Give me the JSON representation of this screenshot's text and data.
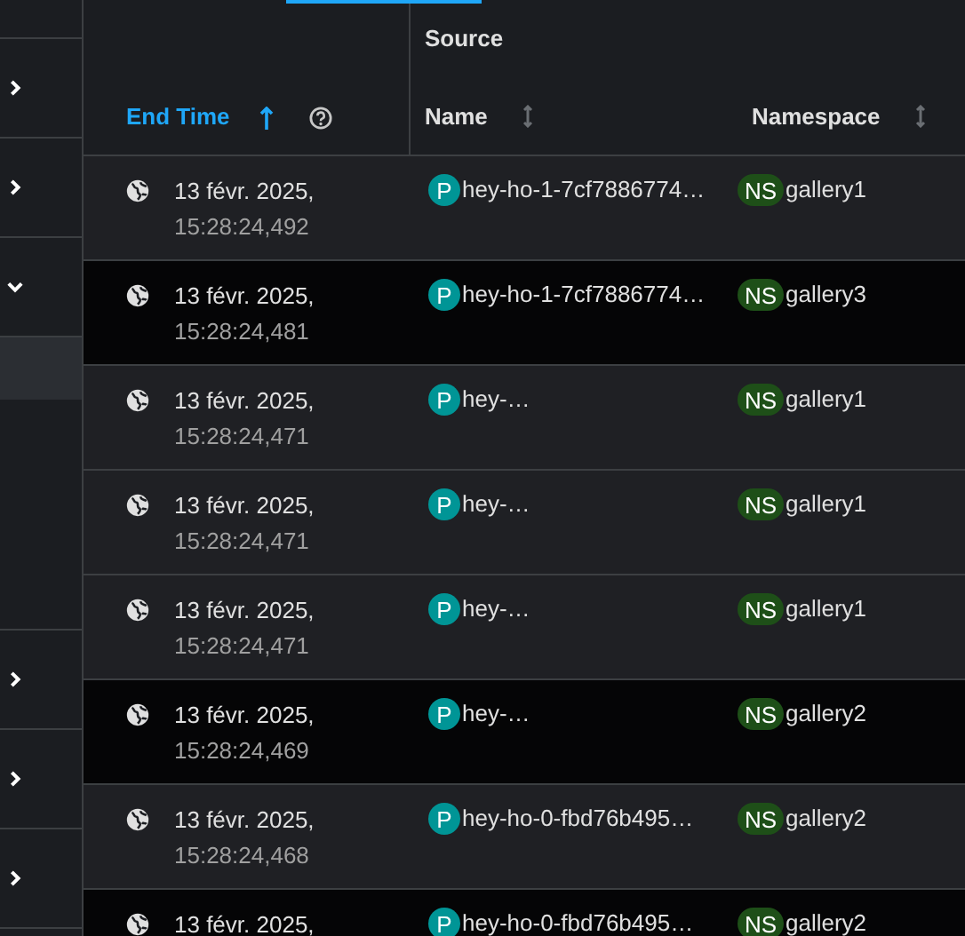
{
  "side_rows": [
    {
      "kind": "spacer"
    },
    {
      "kind": "toggle",
      "expanded": false
    },
    {
      "kind": "toggle",
      "expanded": false
    },
    {
      "kind": "toggle",
      "expanded": true
    },
    {
      "kind": "child"
    },
    {
      "kind": "gap"
    },
    {
      "kind": "toggle",
      "expanded": false
    },
    {
      "kind": "toggle",
      "expanded": false
    },
    {
      "kind": "toggle",
      "expanded": false
    }
  ],
  "table": {
    "group_header": "Source",
    "columns": [
      {
        "label": "End Time",
        "sorted": true,
        "help": true
      },
      {
        "label": "Name",
        "sorted": false
      },
      {
        "label": "Namespace",
        "sorted": false
      }
    ],
    "rows": [
      {
        "date": "13 févr. 2025,",
        "time": "15:28:24,492",
        "badge": "P",
        "name": "hey-ho-1-7cf7886774…",
        "ns_badge": "NS",
        "namespace": "gallery1",
        "selected": false
      },
      {
        "date": "13 févr. 2025,",
        "time": "15:28:24,481",
        "badge": "P",
        "name": "hey-ho-1-7cf7886774…",
        "ns_badge": "NS",
        "namespace": "gallery3",
        "selected": true
      },
      {
        "date": "13 févr. 2025,",
        "time": "15:28:24,471",
        "badge": "P",
        "name": "hey-…",
        "ns_badge": "NS",
        "namespace": "gallery1",
        "selected": false
      },
      {
        "date": "13 févr. 2025,",
        "time": "15:28:24,471",
        "badge": "P",
        "name": "hey-…",
        "ns_badge": "NS",
        "namespace": "gallery1",
        "selected": false
      },
      {
        "date": "13 févr. 2025,",
        "time": "15:28:24,471",
        "badge": "P",
        "name": "hey-…",
        "ns_badge": "NS",
        "namespace": "gallery1",
        "selected": false
      },
      {
        "date": "13 févr. 2025,",
        "time": "15:28:24,469",
        "badge": "P",
        "name": "hey-…",
        "ns_badge": "NS",
        "namespace": "gallery2",
        "selected": true
      },
      {
        "date": "13 févr. 2025,",
        "time": "15:28:24,468",
        "badge": "P",
        "name": "hey-ho-0-fbd76b495…",
        "ns_badge": "NS",
        "namespace": "gallery2",
        "selected": false
      },
      {
        "date": "13 févr. 2025,",
        "badge": "P",
        "name": "hey-ho-0-fbd76b495…",
        "ns_badge": "NS",
        "namespace": "gallery2",
        "selected": true
      }
    ]
  }
}
